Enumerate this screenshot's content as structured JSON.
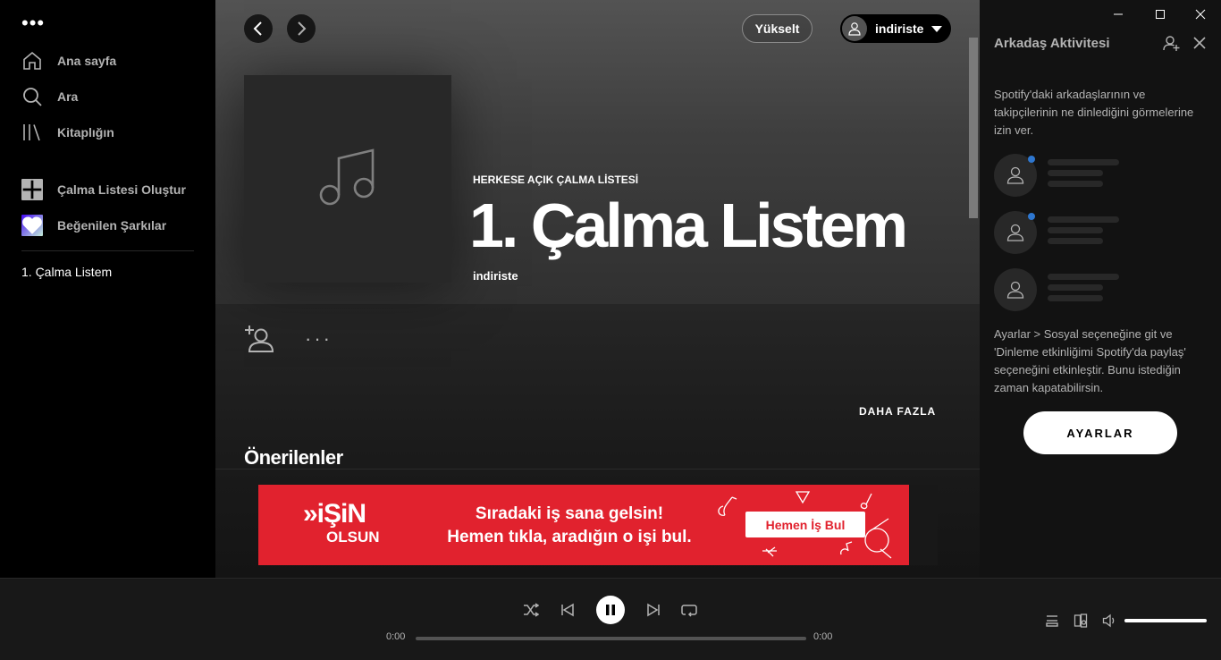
{
  "sidebar": {
    "menu_dots": "•••",
    "nav": [
      {
        "label": "Ana sayfa",
        "icon": "home-icon"
      },
      {
        "label": "Ara",
        "icon": "search-icon"
      },
      {
        "label": "Kitaplığın",
        "icon": "library-icon"
      }
    ],
    "create_playlist": "Çalma Listesi Oluştur",
    "liked_songs": "Beğenilen Şarkılar",
    "playlists": [
      "1. Çalma Listem"
    ]
  },
  "topbar": {
    "upgrade_label": "Yükselt",
    "username": "indiriste"
  },
  "playlist": {
    "type_label": "HERKESE AÇIK ÇALMA LİSTESİ",
    "title": "1. Çalma Listem",
    "owner": "indiriste",
    "more_label": "DAHA FAZLA",
    "recommended_heading": "Önerilenler"
  },
  "ad": {
    "logo_line1": "»iŞiN",
    "logo_line2": "OLSUN",
    "text_line1": "Sıradaki iş sana gelsin!",
    "text_line2": "Hemen tıkla, aradığın o işi bul.",
    "cta": "Hemen İş Bul",
    "color": "#e1222e"
  },
  "friends": {
    "title": "Arkadaş Aktivitesi",
    "description": "Spotify'daki arkadaşlarının ve takipçilerinin ne dinlediğini görmelerine izin ver.",
    "hint": "Ayarlar > Sosyal seçeneğine git ve 'Dinleme etkinliğimi Spotify'da paylaş' seçeneğini etkinleştir. Bunu istediğin zaman kapatabilirsin.",
    "settings_label": "AYARLAR"
  },
  "player": {
    "time_current": "0:00",
    "time_total": "0:00",
    "progress": 0,
    "volume": 1.0
  },
  "colors": {
    "accent_blue": "#2e77d0",
    "background": "#121212",
    "sidebar": "#000000"
  }
}
